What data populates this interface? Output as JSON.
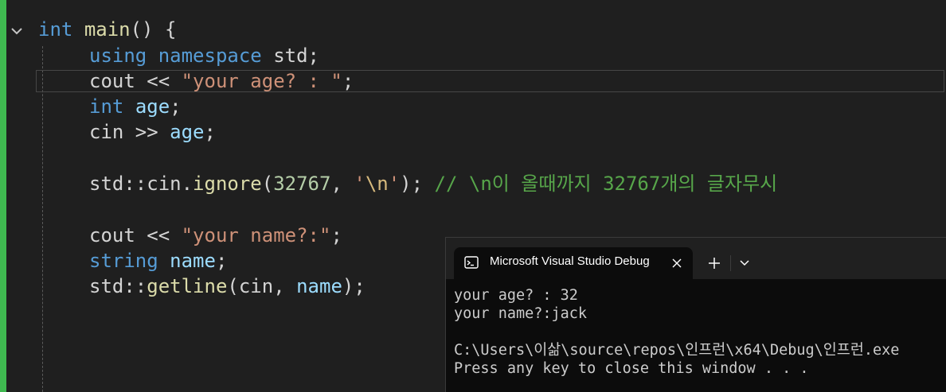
{
  "colors": {
    "editor_bg": "#1f1f1f",
    "change_bar": "#3fb950",
    "keyword": "#569cd6",
    "variable": "#9cdcfe",
    "function": "#dcdcaa",
    "string": "#ce9178",
    "number": "#b5cea8",
    "escape": "#d7ba7d",
    "comment": "#57a64a",
    "type": "#4ec9b0",
    "terminal_bg": "#0c0c0c"
  },
  "editor": {
    "fold_icon": "chevron-down-icon",
    "lines": [
      {
        "tokens": [
          {
            "t": "int",
            "c": "kw"
          },
          {
            "t": " ",
            "c": "plain"
          },
          {
            "t": "main",
            "c": "fn"
          },
          {
            "t": "() {",
            "c": "plain"
          }
        ]
      },
      {
        "tokens": [
          {
            "t": "using",
            "c": "kw"
          },
          {
            "t": " ",
            "c": "plain"
          },
          {
            "t": "namespace",
            "c": "kw"
          },
          {
            "t": " std;",
            "c": "plain"
          }
        ]
      },
      {
        "tokens": [
          {
            "t": "cout << ",
            "c": "plain"
          },
          {
            "t": "\"your age? : \"",
            "c": "str"
          },
          {
            "t": ";",
            "c": "plain"
          }
        ]
      },
      {
        "tokens": [
          {
            "t": "int",
            "c": "kw"
          },
          {
            "t": " ",
            "c": "plain"
          },
          {
            "t": "age",
            "c": "var"
          },
          {
            "t": ";",
            "c": "plain"
          }
        ]
      },
      {
        "tokens": [
          {
            "t": "cin >> ",
            "c": "plain"
          },
          {
            "t": "age",
            "c": "var"
          },
          {
            "t": ";",
            "c": "plain"
          }
        ]
      },
      {
        "tokens": [
          {
            "t": "std::cin.",
            "c": "plain"
          },
          {
            "t": "ignore",
            "c": "fn"
          },
          {
            "t": "(",
            "c": "plain"
          },
          {
            "t": "32767",
            "c": "num"
          },
          {
            "t": ", ",
            "c": "plain"
          },
          {
            "t": "'",
            "c": "str"
          },
          {
            "t": "\\n",
            "c": "esc"
          },
          {
            "t": "'",
            "c": "str"
          },
          {
            "t": "); ",
            "c": "plain"
          },
          {
            "t": "// \\n이 올때까지 32767개의 글자무시",
            "c": "cmt"
          }
        ]
      },
      {
        "tokens": [
          {
            "t": "cout << ",
            "c": "plain"
          },
          {
            "t": "\"your name?:\"",
            "c": "str"
          },
          {
            "t": ";",
            "c": "plain"
          }
        ]
      },
      {
        "tokens": [
          {
            "t": "string",
            "c": "kw"
          },
          {
            "t": " ",
            "c": "plain"
          },
          {
            "t": "name",
            "c": "var"
          },
          {
            "t": ";",
            "c": "plain"
          }
        ]
      },
      {
        "tokens": [
          {
            "t": "std::",
            "c": "plain"
          },
          {
            "t": "getline",
            "c": "fn"
          },
          {
            "t": "(cin, ",
            "c": "plain"
          },
          {
            "t": "name",
            "c": "var"
          },
          {
            "t": ");",
            "c": "plain"
          }
        ]
      }
    ]
  },
  "terminal": {
    "tab_icon": "terminal-icon",
    "tab_title": "Microsoft Visual Studio Debug",
    "close_icon": "close-icon",
    "new_tab_icon": "plus-icon",
    "dropdown_icon": "chevron-down-icon",
    "output": [
      "your age? : 32",
      "your name?:jack",
      "",
      "C:\\Users\\이삶\\source\\repos\\인프런\\x64\\Debug\\인프런.exe",
      "Press any key to close this window . . ."
    ]
  }
}
